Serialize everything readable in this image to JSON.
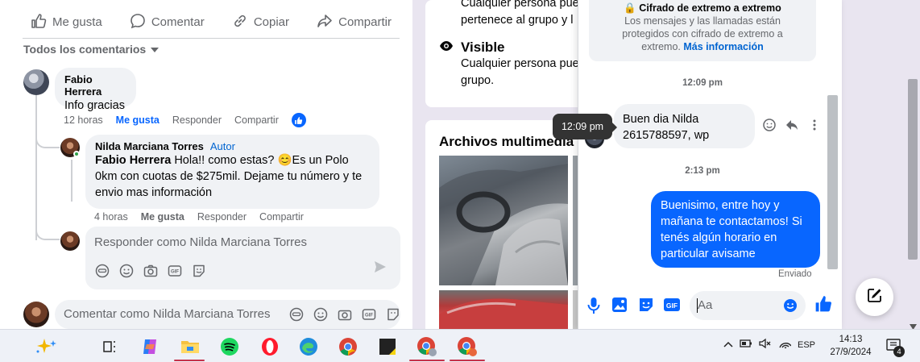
{
  "post_actions": {
    "like": "Me gusta",
    "comment": "Comentar",
    "copy": "Copiar",
    "share": "Compartir"
  },
  "comments_sort": "Todos los comentarios",
  "comments": [
    {
      "author": "Fabio Herrera",
      "text": "Info gracias",
      "time": "12 horas",
      "like": "Me gusta",
      "reply": "Responder",
      "share": "Compartir"
    },
    {
      "author": "Nilda Marciana Torres",
      "badge": "Autor",
      "mention": "Fabio Herrera",
      "text_before_emoji": " Hola!! como estas? ",
      "emoji": "😊",
      "text_after_emoji": "Es un Polo 0km con cuotas de $275mil. Dejame tu número y te envio mas información",
      "time": "4 horas",
      "like": "Me gusta",
      "reply": "Responder",
      "share": "Compartir"
    }
  ],
  "reply_placeholder": "Responder como Nilda Marciana Torres",
  "comment_placeholder": "Comentar como Nilda Marciana Torres",
  "privacy": {
    "text_top_line1": "Cualquier persona pue",
    "text_top_line2": "pertenece al grupo y l",
    "visible_title": "Visible",
    "visible_line1": "Cualquier persona pue",
    "visible_line2": "grupo."
  },
  "media": {
    "title": "Archivos multimedia r"
  },
  "chat": {
    "e2e_title": "Cifrado de extremo a extremo",
    "e2e_text": "Los mensajes y las llamadas están protegidos con cifrado de extremo a extremo.",
    "e2e_link": "Más información",
    "time1": "12:09 pm",
    "incoming_line1": "Buen dia Nilda",
    "incoming_line2": "2615788597, wp",
    "tooltip": "12:09 pm",
    "time2": "2:13 pm",
    "outgoing": "Buenisimo, entre hoy y mañana te contactamos! Si tenés algún horario en particular avisame",
    "sent_status": "Enviado",
    "input_placeholder": "Aa"
  },
  "taskbar": {
    "language": "ESP",
    "time": "14:13",
    "date": "27/9/2024",
    "notification_count": "4"
  },
  "colors": {
    "accent": "#0866ff",
    "link": "#0064d1",
    "secondary_text": "#65676b",
    "bubble_bg": "#f0f2f5"
  }
}
